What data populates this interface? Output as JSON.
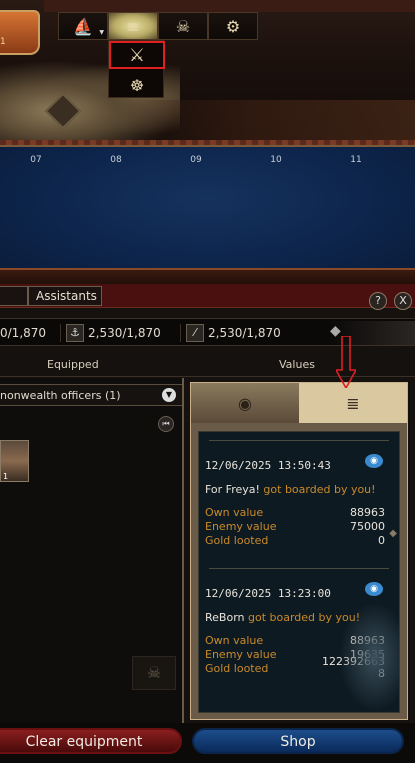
{
  "colors": {
    "accent_red": "#e02020",
    "highlight_orange": "#c98a2a",
    "ocean_blue": "#0d244a"
  },
  "toolbar": {
    "left_badge": "1",
    "icons": [
      "ship-icon",
      "cannon-icon",
      "skull-icon",
      "gears-icon"
    ],
    "dropdown": {
      "items": [
        "crossed-swords-icon",
        "ship-wheel-icon"
      ]
    }
  },
  "chart": {
    "ticks": [
      "07",
      "08",
      "09",
      "10",
      "11"
    ]
  },
  "panel": {
    "tabs": [
      "Assistants"
    ],
    "help_label": "?",
    "close_label": "X",
    "stats": [
      {
        "value": "0/1,870"
      },
      {
        "value": "2,530/1,870"
      },
      {
        "value": "2,530/1,870"
      }
    ],
    "equipped_header": "Equipped",
    "values_header": "Values",
    "officer_select": "nonwealth officers (1)",
    "avatar_level": "1",
    "entries": [
      {
        "date": "12/06/2025 13:50:43",
        "name": "For Freya!",
        "action": "got boarded by you!",
        "own_label": "Own value",
        "own_value": "88963",
        "enemy_label": "Enemy value",
        "enemy_value": "75000",
        "gold_label": "Gold looted",
        "gold_value": "0"
      },
      {
        "date": "12/06/2025 13:23:00",
        "name": "ReBorn",
        "action": "got boarded by you!",
        "own_label": "Own value",
        "own_value": "88963",
        "enemy_label": "Enemy value",
        "enemy_value": "19635",
        "gold_label": "Gold looted",
        "gold_value": "122392663\n8"
      }
    ],
    "buttons": {
      "clear": "Clear equipment",
      "shop": "Shop"
    }
  }
}
